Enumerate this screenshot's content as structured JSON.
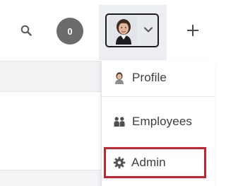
{
  "toolbar": {
    "notification_count": "0",
    "search_icon": "search-icon",
    "add_icon": "plus-icon",
    "avatar": {
      "icon": "user-avatar",
      "chevron_icon": "chevron-down-icon"
    }
  },
  "user_menu": {
    "items": [
      {
        "label": "Profile",
        "icon": "user-icon"
      },
      {
        "label": "Employees",
        "icon": "users-icon"
      },
      {
        "label": "Admin",
        "icon": "gear-icon",
        "highlighted": true
      }
    ]
  },
  "colors": {
    "badge": "#6b6b6b",
    "highlight_border": "#d0202e",
    "avatar_bg": "#eceef1"
  }
}
